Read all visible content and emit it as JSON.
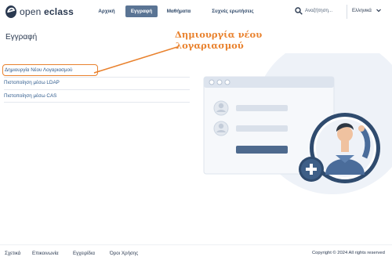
{
  "brand": {
    "name_part1": "open",
    "name_part2": "eclass"
  },
  "nav": [
    {
      "label": "Αρχική"
    },
    {
      "label": "Εγγραφή"
    },
    {
      "label": "Μαθήματα"
    },
    {
      "label": "Συχνές ερωτήσεις"
    }
  ],
  "search": {
    "placeholder": "Αναζήτηση..."
  },
  "language": {
    "selected": "Ελληνικά"
  },
  "page": {
    "title": "Εγγραφή"
  },
  "annotation": {
    "line1": "Δημιουργία νέου",
    "line2": "λογαριασμού"
  },
  "menu": [
    {
      "label": "Δημιουργία Νέου Λογαριασμού"
    },
    {
      "label": "Πιστοποίηση μέσω LDAP"
    },
    {
      "label": "Πιστοποίηση μέσω CAS"
    }
  ],
  "footer": {
    "links": [
      "Σχετικά",
      "Επικοινωνία",
      "Εγχειρίδια",
      "Όροι Χρήσης"
    ],
    "copyright": "Copyright © 2024 All rights reserved"
  },
  "colors": {
    "accent": "#e9822e",
    "primary": "#2a3950",
    "nav_active": "#5a7494",
    "link": "#2e5a8c"
  }
}
